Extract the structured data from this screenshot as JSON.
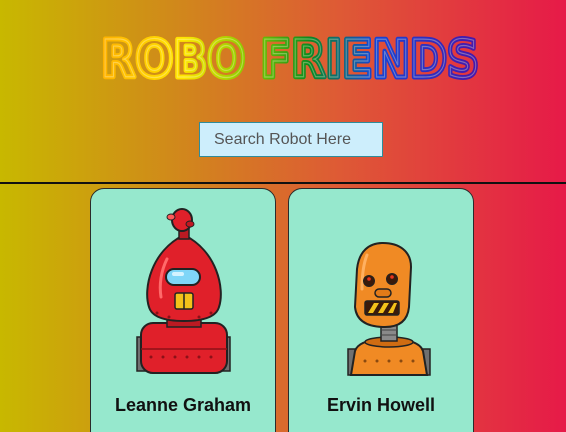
{
  "header": {
    "title": "ROBO FRIENDS"
  },
  "search": {
    "placeholder": "Search Robot Here",
    "value": ""
  },
  "robots": [
    {
      "name": "Leanne Graham"
    },
    {
      "name": "Ervin Howell"
    }
  ]
}
